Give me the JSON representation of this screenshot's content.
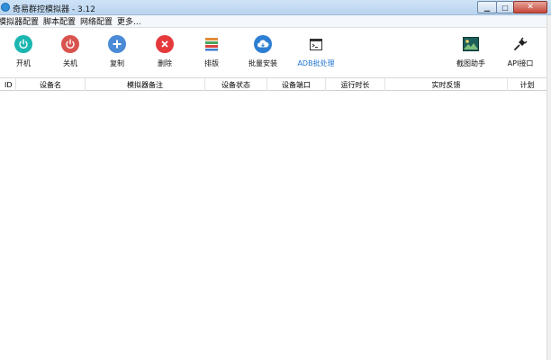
{
  "window": {
    "title": "奇易群控模拟器 - 3.12",
    "controls": {
      "minimize": "▁",
      "maximize": "□",
      "close": "✕"
    }
  },
  "menu": {
    "items": [
      "模拟器配置",
      "脚本配置",
      "网络配置",
      "更多..."
    ]
  },
  "toolbar": {
    "buttons": [
      {
        "label": "开机",
        "icon": "power-icon",
        "color": "#1ab6b0"
      },
      {
        "label": "关机",
        "icon": "power-off-icon",
        "color": "#d9534f"
      },
      {
        "label": "复制",
        "icon": "plus-icon",
        "color": "#4a8ad6"
      },
      {
        "label": "删除",
        "icon": "delete-icon",
        "color": "#e5393c"
      },
      {
        "label": "排版",
        "icon": "layout-icon",
        "color": "#e28b3a"
      },
      {
        "label": "批量安装",
        "icon": "cloud-install-icon",
        "color": "#2d7fd3"
      },
      {
        "label": "ADB批处理",
        "icon": "terminal-icon",
        "color": "#333333"
      },
      {
        "label": "截图助手",
        "icon": "image-icon",
        "color": "#1d5f5a"
      },
      {
        "label": "API接口",
        "icon": "plug-icon",
        "color": "#222222"
      }
    ],
    "active_color": "#1e74d0"
  },
  "table": {
    "columns": [
      "ID",
      "设备名",
      "模拟器备注",
      "设备状态",
      "设备端口",
      "运行时长",
      "实时反馈",
      "计划"
    ],
    "rows": []
  }
}
